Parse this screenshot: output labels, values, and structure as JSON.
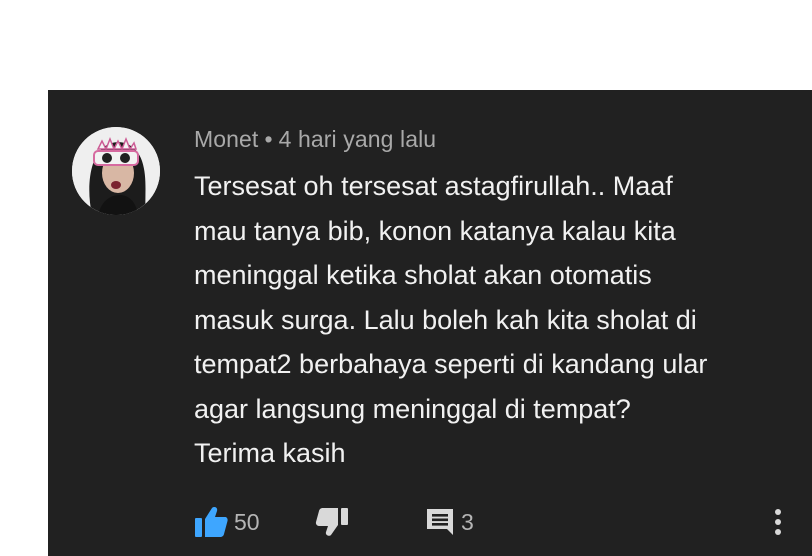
{
  "comment": {
    "author": "Monet",
    "separator": "•",
    "timestamp": "4 hari yang lalu",
    "text_lines": [
      "Tersesat oh tersesat astagfirullah.. Maaf",
      "mau tanya bib, konon katanya kalau kita",
      "meninggal ketika sholat akan otomatis",
      "masuk surga. Lalu boleh kah kita sholat di",
      "tempat2 berbahaya seperti di kandang ular",
      "agar langsung meninggal di tempat?",
      "Terima kasih"
    ],
    "avatar_icon": "profile-photo-avatar"
  },
  "actions": {
    "like_icon": "thumbs-up-icon",
    "like_count": "50",
    "dislike_icon": "thumbs-down-icon",
    "reply_icon": "comment-icon",
    "reply_count": "3",
    "more_icon": "more-vertical-icon"
  },
  "colors": {
    "card_background": "#212121",
    "text_primary": "#f1f1f1",
    "text_secondary": "#a9a9a9",
    "like_active": "#3ea6ff",
    "icon_neutral": "#d9d9d9"
  }
}
